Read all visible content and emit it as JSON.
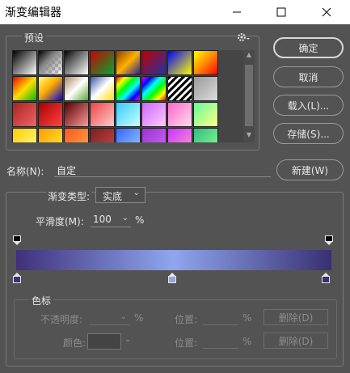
{
  "window": {
    "title": "渐变编辑器"
  },
  "icons": {
    "minimize": "minimize-icon",
    "maximize": "maximize-icon",
    "close": "close-icon",
    "gear": "gear-icon"
  },
  "presets": {
    "label": "预设",
    "swatches": [
      "linear-gradient(135deg,#000 0%,#fff 100%)",
      "linear-gradient(135deg,#000 0%,#888 40%,transparent 100%)",
      "linear-gradient(135deg,#000 0%,#555 30%,#fff 100%)",
      "linear-gradient(135deg,#c00 0%,#0a3 100%)",
      "linear-gradient(135deg,#8b4000 0%,#ffb200 50%,#1f1f9f 100%)",
      "linear-gradient(135deg,#b00 0%,#23a 100%)",
      "linear-gradient(135deg,#00f 0%,#ff0 100%)",
      "linear-gradient(135deg,#ff0 0%,#f80 50%,#f00 100%)",
      "linear-gradient(135deg,#e00 0%,#fd0 50%,#0b0 100%)",
      "linear-gradient(135deg,#ff7 0%,#fa0 45%,#00d 100%)",
      "linear-gradient(135deg,#a86 0%,#fff 50%,#5a3 100%)",
      "linear-gradient(135deg,#35a 0%,#fff 50%,#fd0 100%)",
      "linear-gradient(135deg,#f00,#ff0,#0f0,#0ff,#00f,#f0f)",
      "linear-gradient(135deg,#f0f,#00f,#0ff,#0f0,#ff0,#f00)",
      "repeating-linear-gradient(135deg,#000 0 3px,#fff 3px 6px)",
      "linear-gradient(135deg,#999 0%,#ddd 100%)",
      "linear-gradient(135deg,#a22 0%,#e66 100%)",
      "linear-gradient(135deg,#a00 0%,#f44 100%)",
      "linear-gradient(135deg,#500 0%,#f99 100%)",
      "linear-gradient(135deg,#e44 0%,#fcc 100%)",
      "linear-gradient(135deg,#3cf 0%,#cff 100%)",
      "linear-gradient(135deg,#c6f 0%,#fcf 100%)",
      "linear-gradient(135deg,#f6c 0%,#fde 100%)",
      "linear-gradient(135deg,#6f9 0%,#ff8 100%)",
      "linear-gradient(135deg,#fc0 0%,#ff8 100%)",
      "linear-gradient(135deg,#f90 0%,#fe3 100%)",
      "linear-gradient(135deg,#f52 0%,#fa4 100%)",
      "linear-gradient(135deg,#722 0%,#c44 100%)",
      "linear-gradient(135deg,#36f 0%,#9cf 100%)",
      "linear-gradient(135deg,#93c 0%,#c6f 100%)",
      "linear-gradient(135deg,#c3f 0%,#f9c 100%)",
      "linear-gradient(135deg,#3b8 0%,#8f8 100%)"
    ]
  },
  "buttons": {
    "ok": "确定",
    "cancel": "取消",
    "load": "载入(L)...",
    "save": "存储(S)...",
    "new": "新建(W)"
  },
  "name": {
    "label": "名称(N):",
    "value": "自定"
  },
  "gradient": {
    "type_label": "渐变类型:",
    "type_value": "实底",
    "smoothness_label": "平滑度(M):",
    "smoothness_value": "100",
    "smoothness_unit": "%",
    "colors": {
      "left": "#3f307a",
      "mid": "#8fa6ef",
      "right": "#3a2f72"
    }
  },
  "color_stops": {
    "label": "色标",
    "opacity_label": "不透明度:",
    "opacity_unit": "%",
    "location_label": "位置:",
    "location_unit": "%",
    "delete_label": "删除(D)",
    "color_label": "颜色:",
    "location_label_2": "位置:",
    "location_unit_2": "%",
    "delete_label_2": "删除(D)"
  }
}
